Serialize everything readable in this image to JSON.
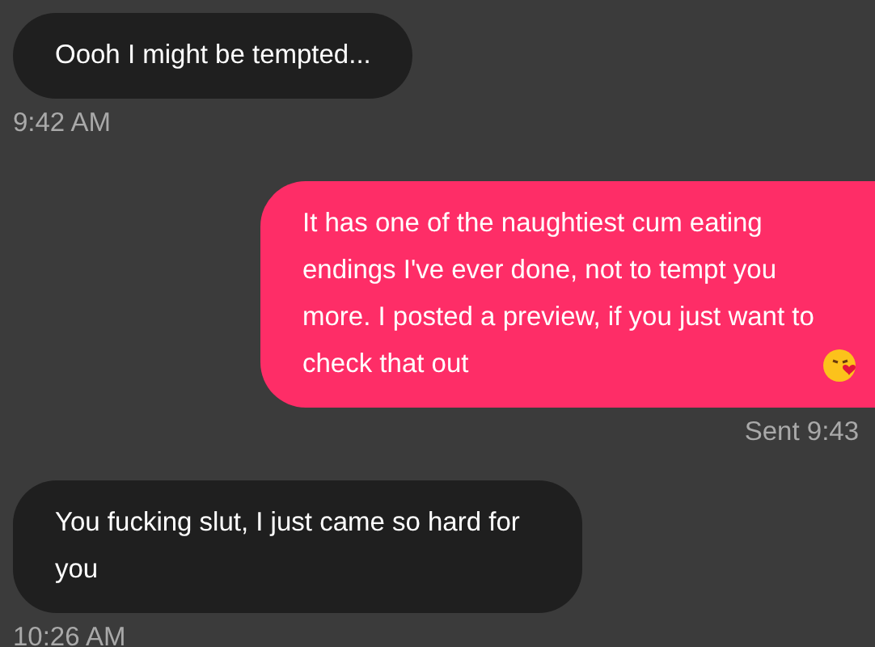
{
  "messages": [
    {
      "kind": "received",
      "text": "Oooh I might be tempted...",
      "time": "9:42 AM",
      "emoji": false
    },
    {
      "kind": "sent",
      "text": "It has one of the naughtiest cum eating endings I've ever done, not to tempt you more. I posted a preview, if you just want to check that out",
      "time": "Sent 9:43",
      "emoji": true
    },
    {
      "kind": "received",
      "text": "You fucking slut, I just came so hard for you",
      "time": "10:26 AM",
      "emoji": false
    }
  ]
}
